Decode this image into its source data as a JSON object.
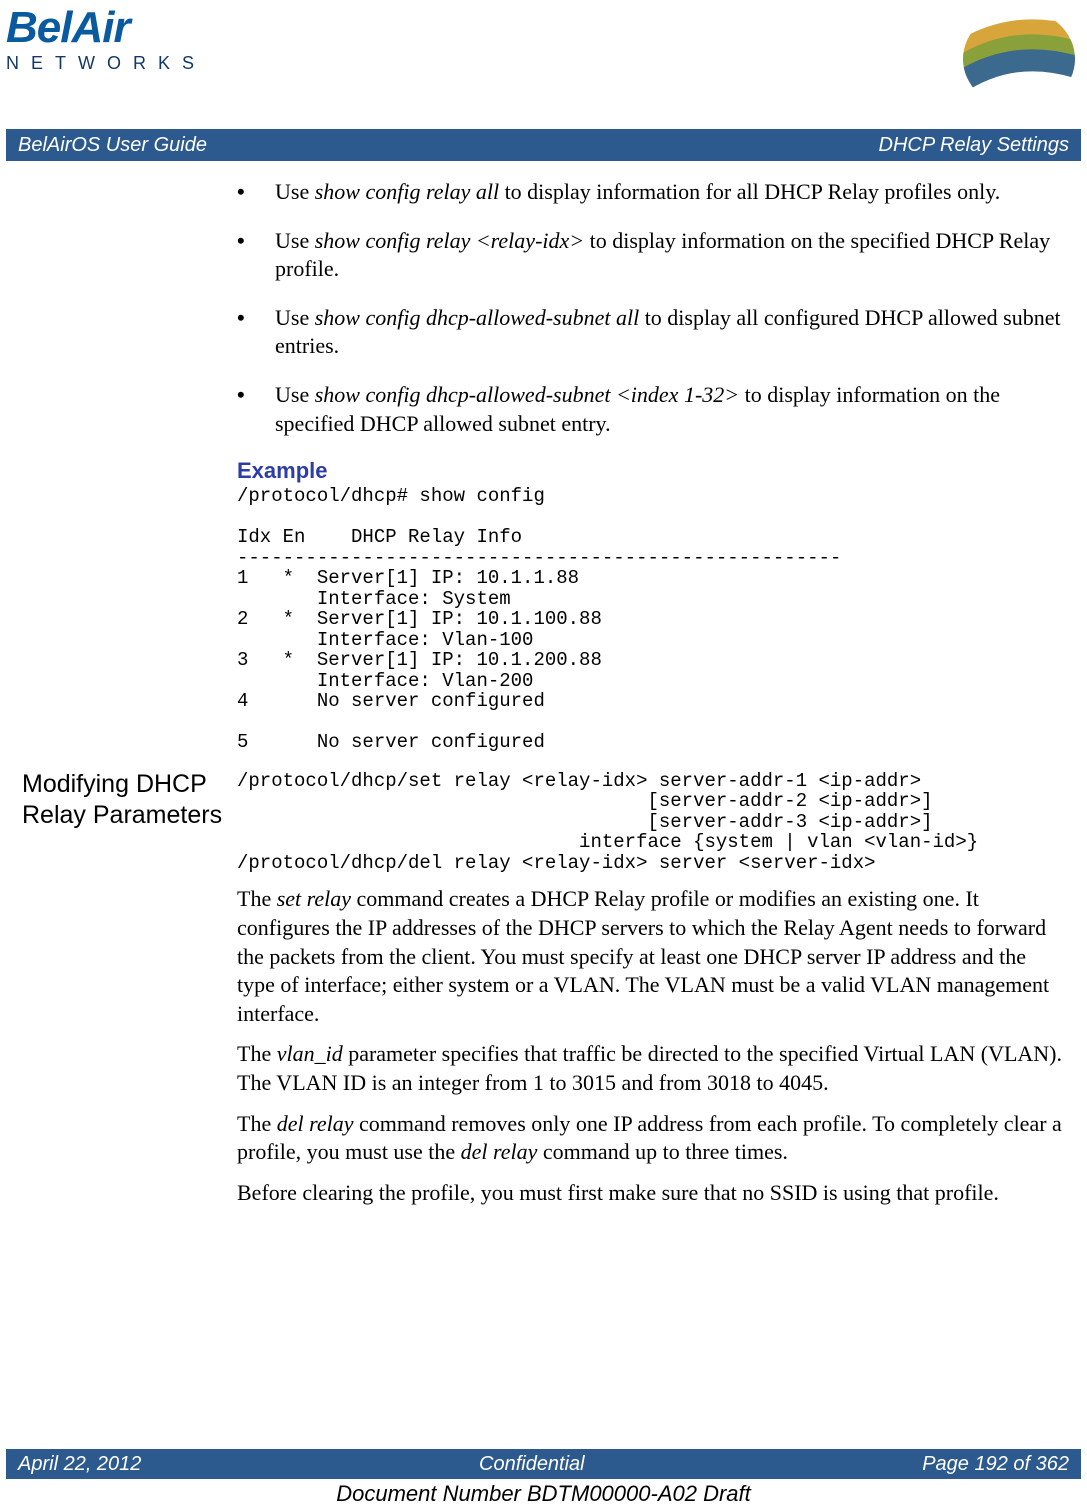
{
  "brand": {
    "name": "BelAir",
    "subname": "NETWORKS"
  },
  "header": {
    "left": "BelAirOS User Guide",
    "right": "DHCP Relay Settings"
  },
  "bullets": [
    {
      "pre": "Use ",
      "cmd": "show config relay all",
      "post": " to display information for all DHCP Relay profiles only."
    },
    {
      "pre": "Use ",
      "cmd": "show config relay <relay-idx>",
      "post": " to display information on the specified DHCP Relay profile."
    },
    {
      "pre": "Use ",
      "cmd": "show config dhcp-allowed-subnet all",
      "post": " to display all configured DHCP allowed subnet entries."
    },
    {
      "pre": "Use ",
      "cmd": "show config dhcp-allowed-subnet <index 1-32>",
      "post": " to display information on the specified DHCP allowed subnet entry."
    }
  ],
  "example_heading": "Example",
  "example_block": "/protocol/dhcp# show config\n\nIdx En    DHCP Relay Info\n-----------------------------------------------------\n1   *  Server[1] IP: 10.1.1.88\n       Interface: System\n2   *  Server[1] IP: 10.1.100.88\n       Interface: Vlan-100\n3   *  Server[1] IP: 10.1.200.88\n       Interface: Vlan-200\n4      No server configured\n\n5      No server configured",
  "section_heading": "Modifying DHCP Relay Parameters",
  "syntax_block": "/protocol/dhcp/set relay <relay-idx> server-addr-1 <ip-addr>\n                                    [server-addr-2 <ip-addr>]\n                                    [server-addr-3 <ip-addr>]\n                              interface {system | vlan <vlan-id>}\n/protocol/dhcp/del relay <relay-idx> server <server-idx>",
  "p1": {
    "a": "The ",
    "cmd": "set relay",
    "b": " command creates a DHCP Relay profile or modifies an existing one. It configures the IP addresses of the DHCP servers to which the Relay Agent needs to forward the packets from the client. You must specify at least one DHCP server IP address and the type of interface; either system or a VLAN. The VLAN must be a valid VLAN management interface."
  },
  "p2": {
    "a": "The ",
    "cmd": "vlan_id",
    "b": " parameter specifies that traffic be directed to the specified Virtual LAN (VLAN). The VLAN ID is an integer from 1 to 3015 and from 3018 to 4045."
  },
  "p3": {
    "a": "The ",
    "cmd": "del relay",
    "b": " command removes only one IP address from each profile. To completely clear a profile, you must use the ",
    "cmd2": "del relay",
    "c": " command up to three times."
  },
  "p4": "Before clearing the profile, you must first make sure that no SSID is using that profile.",
  "footer": {
    "left": "April 22, 2012",
    "center": "Confidential",
    "right": "Page 192 of 362"
  },
  "docnum": "Document Number BDTM00000-A02 Draft"
}
